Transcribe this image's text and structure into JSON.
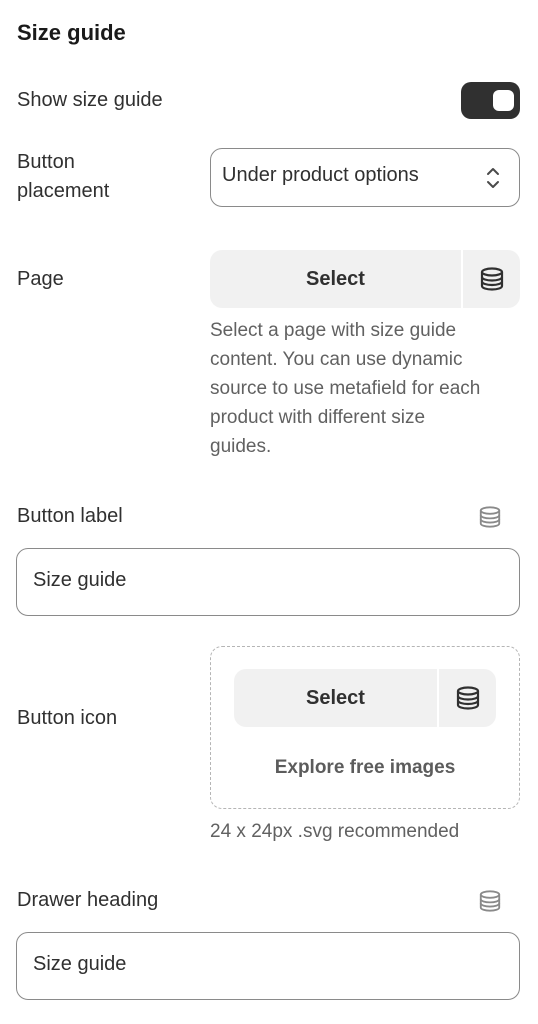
{
  "section": {
    "title": "Size guide"
  },
  "show_size_guide": {
    "label": "Show size guide",
    "enabled": true
  },
  "button_placement": {
    "label": "Button\nplacement",
    "label_line1": "Button",
    "label_line2": "placement",
    "value": "Under product options"
  },
  "page": {
    "label": "Page",
    "select_label": "Select",
    "help": "Select a page with size guide content. You can use dynamic source to use metafield for each product with different size guides.",
    "help_lines": [
      "Select a page with size guide",
      "content. You can use dynamic",
      "source to use metafield for each",
      "product with different size",
      "guides."
    ]
  },
  "button_label": {
    "label": "Button label",
    "value": "Size guide"
  },
  "button_icon": {
    "label": "Button icon",
    "select_label": "Select",
    "explore_label": "Explore free images",
    "help": "24 x 24px .svg recommended"
  },
  "drawer_heading": {
    "label": "Drawer heading",
    "value": "Size guide"
  },
  "colors": {
    "text": "#303030",
    "muted": "#616161",
    "toggle_on": "#303030",
    "picker_bg": "#f1f1f1",
    "border": "#8a8a8a"
  },
  "icons": {
    "dynamic_source": "database-icon",
    "chevrons": "chevron-up-down-icon"
  }
}
